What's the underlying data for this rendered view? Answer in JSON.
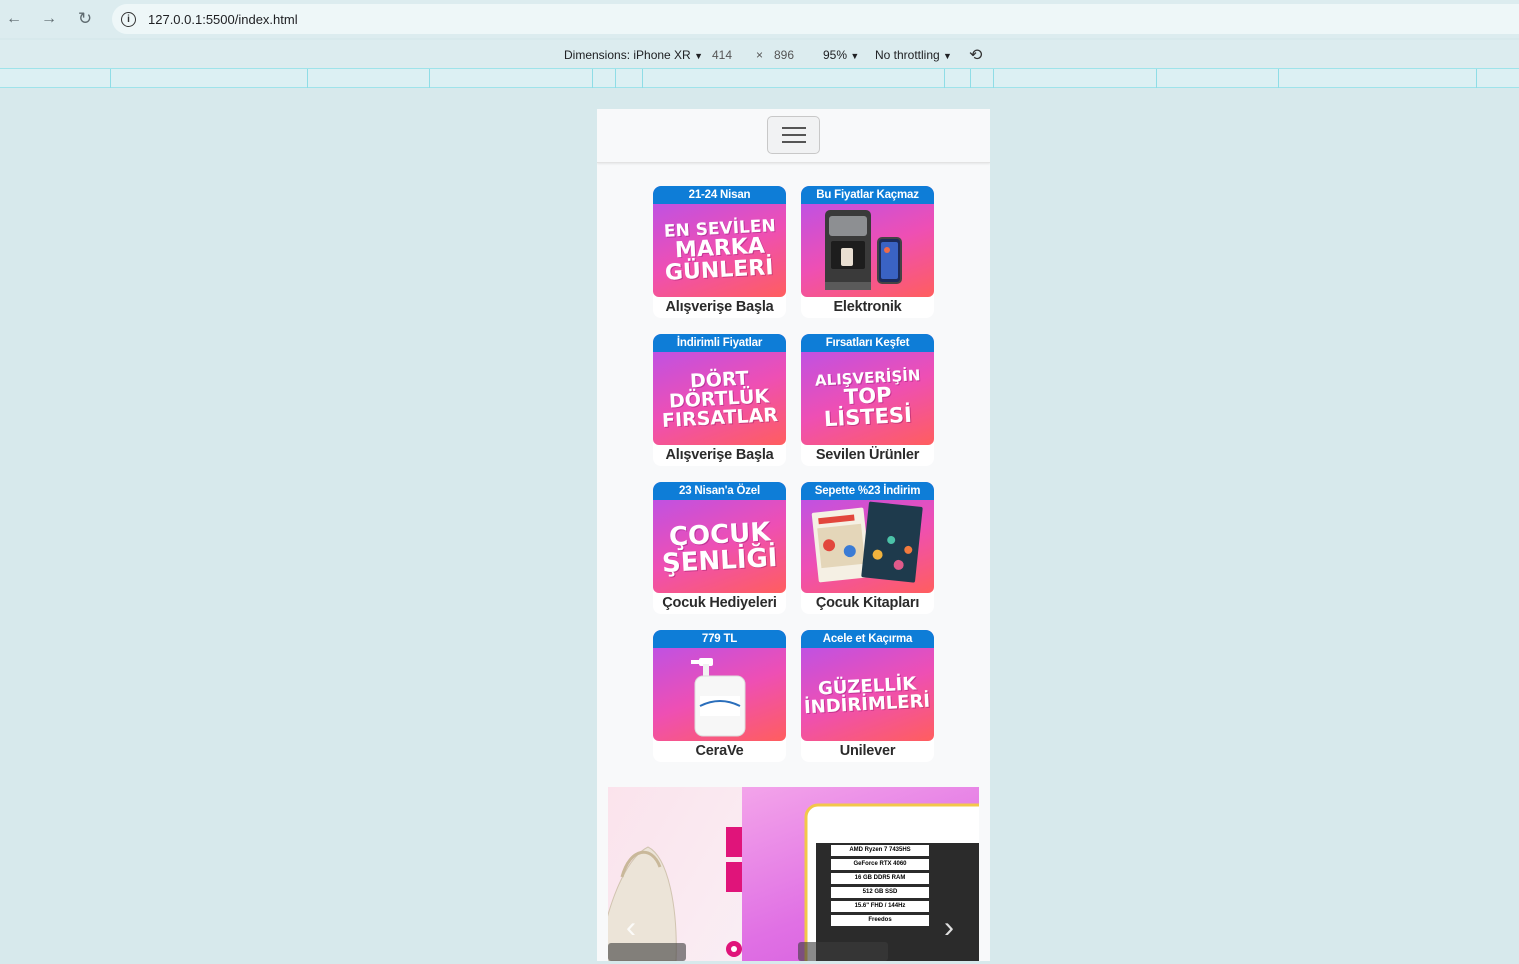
{
  "browser": {
    "url": "127.0.0.1:5500/index.html"
  },
  "devtools": {
    "dimensions_label": "Dimensions: iPhone XR",
    "width": "414",
    "times": "×",
    "height": "896",
    "zoom": "95%",
    "throttling": "No throttling"
  },
  "cards": [
    {
      "tag": "21-24 Nisan",
      "big": [
        "EN SEVİLEN",
        "MARKA",
        "GÜNLERİ"
      ],
      "label": "Alışverişe Başla"
    },
    {
      "tag": "Bu Fiyatlar Kaçmaz",
      "big": [],
      "label": "Elektronik"
    },
    {
      "tag": "İndirimli Fiyatlar",
      "big": [
        "DÖRT",
        "DÖRTLÜK",
        "FIRSATLAR"
      ],
      "label": "Alışverişe Başla"
    },
    {
      "tag": "Fırsatları Keşfet",
      "big": [
        "ALIŞVERİŞİN",
        "TOP",
        "LİSTESİ"
      ],
      "label": "Sevilen Ürünler"
    },
    {
      "tag": "23 Nisan'a Özel",
      "big": [
        "ÇOCUK",
        "ŞENLİĞİ"
      ],
      "label": "Çocuk Hediyeleri"
    },
    {
      "tag": "Sepette %23 İndirim",
      "big": [],
      "label": "Çocuk Kitapları"
    },
    {
      "tag": "779 TL",
      "big": [],
      "label": "CeraVe"
    },
    {
      "tag": "Acele et Kaçırma",
      "big": [
        "GÜZELLİK",
        "İNDİRİMLERİ"
      ],
      "label": "Unilever"
    }
  ],
  "carousel": {
    "laptop_specs": [
      "AMD Ryzen 7 7435HS",
      "GeForce RTX 4060",
      "16 GB DDR5 RAM",
      "512 GB SSD",
      "15.6\" FHD / 144Hz",
      "Freedos"
    ]
  }
}
